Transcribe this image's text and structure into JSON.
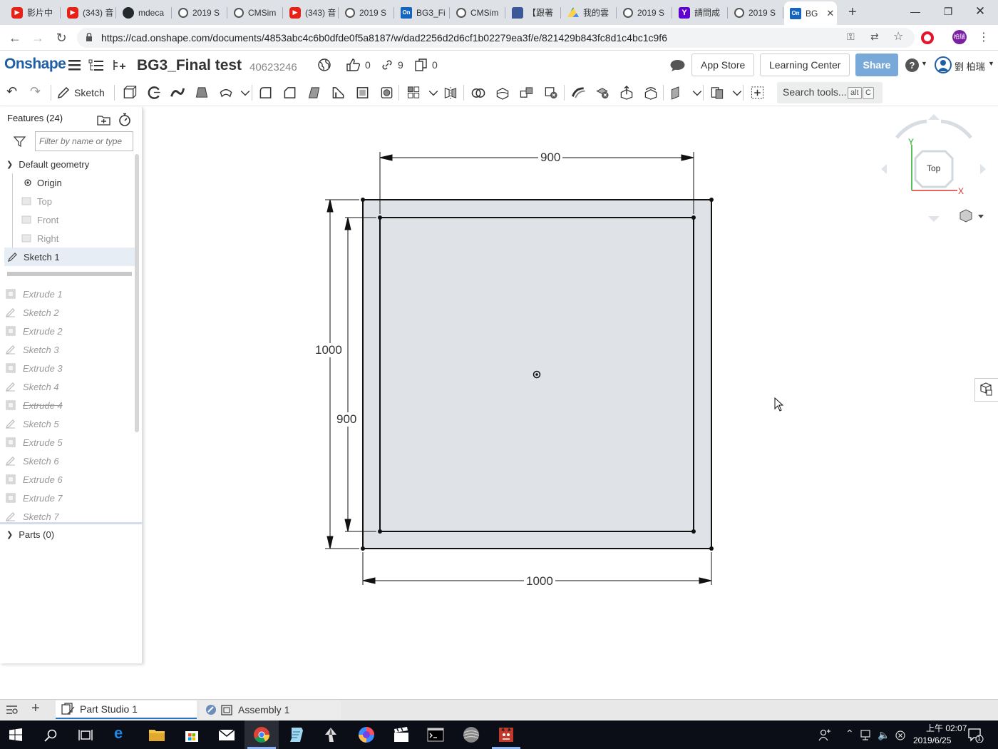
{
  "browser": {
    "tabs": [
      {
        "label": "影片中",
        "icon": "youtube-icon"
      },
      {
        "label": "(343) 音",
        "icon": "youtube-icon"
      },
      {
        "label": "mdeca",
        "icon": "github-icon"
      },
      {
        "label": "2019 S",
        "icon": "globe-icon"
      },
      {
        "label": "CMSim",
        "icon": "globe-icon"
      },
      {
        "label": "(343) 音",
        "icon": "youtube-icon"
      },
      {
        "label": "2019 S",
        "icon": "globe-icon"
      },
      {
        "label": "BG3_Fi",
        "icon": "onshape-icon"
      },
      {
        "label": "CMSim",
        "icon": "globe-icon"
      },
      {
        "label": "【跟著",
        "icon": "chat-icon"
      },
      {
        "label": "我的雲",
        "icon": "drive-icon"
      },
      {
        "label": "2019 S",
        "icon": "globe-icon"
      },
      {
        "label": "請問成",
        "icon": "yahoo-icon"
      },
      {
        "label": "2019 S",
        "icon": "globe-icon"
      },
      {
        "label": "BG",
        "icon": "onshape-icon",
        "active": true
      }
    ],
    "url": "https://cad.onshape.com/documents/4853abc4c6b0dfde0f5a8187/w/dad2256d2d6cf1b02279ea3f/e/821429b843fc8d1c4bc1c9f6",
    "profile_initials": "柏瑞",
    "onshape_badge": "On"
  },
  "header": {
    "logo": "Onshape",
    "doc_title": "BG3_Final test",
    "doc_id": "40623246",
    "likes": "0",
    "links": "9",
    "copies": "0",
    "app_store": "App Store",
    "learning_center": "Learning Center",
    "share": "Share",
    "help": "?",
    "user_name": "劉 柏瑞"
  },
  "toolbar": {
    "sketch_label": "Sketch",
    "search_label": "Search tools...",
    "search_key1": "alt",
    "search_key2": "C"
  },
  "feature_panel": {
    "title": "Features (24)",
    "filter_placeholder": "Filter by name or type",
    "default_geometry": "Default geometry",
    "origin": "Origin",
    "planes": [
      "Top",
      "Front",
      "Right"
    ],
    "active_sketch": "Sketch 1",
    "rolled_back": [
      {
        "label": "Extrude 1",
        "kind": "extrude"
      },
      {
        "label": "Sketch 2",
        "kind": "sketch"
      },
      {
        "label": "Extrude 2",
        "kind": "extrude"
      },
      {
        "label": "Sketch 3",
        "kind": "sketch"
      },
      {
        "label": "Extrude 3",
        "kind": "extrude"
      },
      {
        "label": "Sketch 4",
        "kind": "sketch"
      },
      {
        "label": "Extrude 4",
        "kind": "extrude",
        "suppressed": true
      },
      {
        "label": "Sketch 5",
        "kind": "sketch"
      },
      {
        "label": "Extrude 5",
        "kind": "extrude"
      },
      {
        "label": "Sketch 6",
        "kind": "sketch"
      },
      {
        "label": "Extrude 6",
        "kind": "extrude"
      },
      {
        "label": "Extrude 7",
        "kind": "extrude"
      },
      {
        "label": "Sketch 7",
        "kind": "sketch"
      }
    ],
    "parts": "Parts (0)"
  },
  "viewport": {
    "dim_top": "900",
    "dim_bottom": "1000",
    "dim_left_outer": "1000",
    "dim_left_inner": "900",
    "view_cube_face": "Top",
    "axis_x": "X",
    "axis_y": "Y",
    "sketch_fill": "#dfe3e7"
  },
  "bottom_tabs": {
    "part_studio": "Part Studio 1",
    "assembly": "Assembly 1"
  },
  "taskbar": {
    "time": "上午 02:07",
    "date": "2019/6/25",
    "notification_count": "1"
  }
}
